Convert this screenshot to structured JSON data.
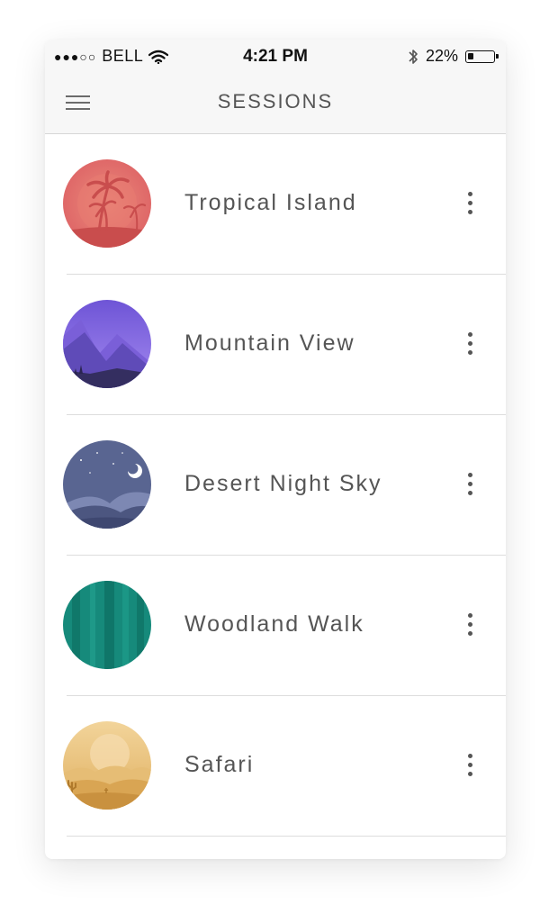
{
  "status_bar": {
    "signal_dots": "●●●○○",
    "carrier": "BELL",
    "time": "4:21 PM",
    "battery_percent": "22%",
    "battery_level": 0.22,
    "wifi_icon": "wifi-icon",
    "bluetooth_icon": "bluetooth-icon"
  },
  "header": {
    "title": "SESSIONS",
    "menu_icon": "hamburger-menu-icon"
  },
  "sessions": [
    {
      "title": "Tropical Island",
      "icon": "tropical-island-icon",
      "color": "#e06b6b"
    },
    {
      "title": "Mountain View",
      "icon": "mountain-view-icon",
      "color": "#8a6ae0"
    },
    {
      "title": "Desert Night Sky",
      "icon": "desert-night-sky-icon",
      "color": "#5a6591"
    },
    {
      "title": "Woodland Walk",
      "icon": "woodland-walk-icon",
      "color": "#158a7b"
    },
    {
      "title": "Safari",
      "icon": "safari-icon",
      "color": "#e2b86f"
    }
  ],
  "more_icon": "more-vertical-icon"
}
